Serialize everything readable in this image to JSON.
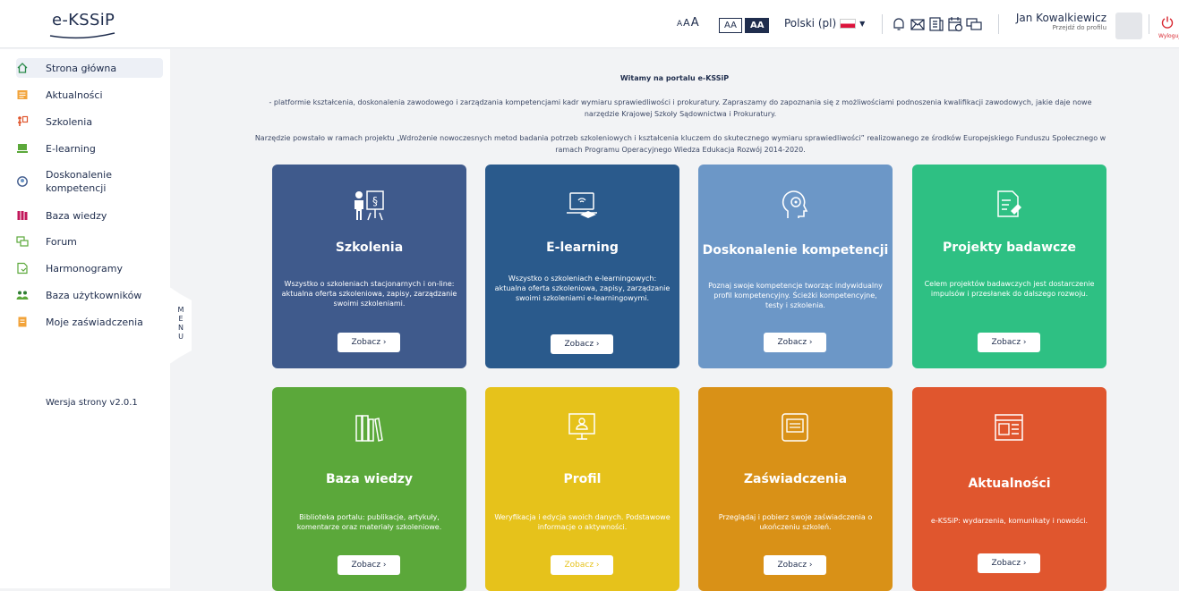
{
  "header": {
    "logo": "e-KSSiP",
    "font_sizes": [
      "A",
      "A",
      "A"
    ],
    "contrast": [
      "AA",
      "AA"
    ],
    "language": "Polski (pl)",
    "user_name": "Jan Kowalkiewicz",
    "user_link": "Przejdź do profilu",
    "logout_label": "Wyloguj"
  },
  "sidebar": {
    "items": [
      {
        "label": "Strona główna",
        "icon": "home-icon"
      },
      {
        "label": "Aktualności",
        "icon": "news-icon"
      },
      {
        "label": "Szkolenia",
        "icon": "training-icon"
      },
      {
        "label": "E-learning",
        "icon": "elearning-icon"
      },
      {
        "label": "Doskonalenie kompetencji",
        "icon": "competence-icon"
      },
      {
        "label": "Baza wiedzy",
        "icon": "library-icon"
      },
      {
        "label": "Forum",
        "icon": "forum-icon"
      },
      {
        "label": "Harmonogramy",
        "icon": "schedule-icon"
      },
      {
        "label": "Baza użytkowników",
        "icon": "users-icon"
      },
      {
        "label": "Moje zaświadczenia",
        "icon": "certificate-icon"
      }
    ],
    "version": "Wersja strony v2.0.1",
    "menu_tab": "MENU"
  },
  "main": {
    "welcome": "Witamy na portalu e-KSSiP",
    "intro_1": "- platformie kształcenia, doskonalenia zawodowego i zarządzania kompetencjami kadr wymiaru sprawiedliwości i prokuratury. Zapraszamy do zapoznania się z możliwościami podnoszenia kwalifikacji zawodowych, jakie daje nowe narzędzie Krajowej Szkoły Sądownictwa i Prokuratury.",
    "intro_2": "Narzędzie powstało w ramach projektu „Wdrożenie nowoczesnych metod badania potrzeb szkoleniowych i kształcenia kluczem do skutecznego wymiaru sprawiedliwości” realizowanego ze środków Europejskiego Funduszu Społecznego w ramach Programu Operacyjnego Wiedza Edukacja Rozwój 2014-2020.",
    "cards": [
      {
        "title": "Szkolenia",
        "desc": "Wszystko o szkoleniach stacjonarnych i on-line: aktualna oferta szkoleniowa, zapisy, zarządzanie swoimi szkoleniami.",
        "button": "Zobacz  ›",
        "color": "#3f5a8c",
        "icon": "trainer-board-icon"
      },
      {
        "title": "E-learning",
        "desc": "Wszystko o szkoleniach e-learningowych: aktualna oferta szkoleniowa, zapisy, zarządzanie swoimi szkoleniami e-learningowymi.",
        "button": "Zobacz  ›",
        "color": "#2a5a8c",
        "icon": "laptop-graduation-icon"
      },
      {
        "title": "Doskonalenie kompetencji",
        "desc": "Poznaj swoje kompetencje tworząc indywidualny profil kompetencyjny. Ścieżki kompetencyjne, testy i szkolenia.",
        "button": "Zobacz  ›",
        "color": "#6c97c7",
        "icon": "head-gear-icon"
      },
      {
        "title": "Projekty badawcze",
        "desc": "Celem projektów badawczych jest dostarczenie impulsów i przesłanek do dalszego rozwoju.",
        "button": "Zobacz  ›",
        "color": "#2ec083",
        "icon": "research-doc-icon"
      },
      {
        "title": "Baza wiedzy",
        "desc": "Biblioteka portalu: publikacje, artykuły, komentarze oraz materiały szkoleniowe.",
        "button": "Zobacz  ›",
        "color": "#5ba83a",
        "icon": "books-icon"
      },
      {
        "title": "Profil",
        "desc": "Weryfikacja i edycja swoich danych. Podstawowe informacje o aktywności.",
        "button": "Zobacz  ›",
        "color": "#e6c21b",
        "icon": "profile-monitor-icon"
      },
      {
        "title": "Zaświadczenia",
        "desc": "Przeglądaj i pobierz swoje zaświadczenia o ukończeniu szkoleń.",
        "button": "Zobacz  ›",
        "color": "#d99117",
        "icon": "certificate-frame-icon"
      },
      {
        "title": "Aktualności",
        "desc": "e-KSSiP: wydarzenia, komunikaty i nowości.",
        "button": "Zobacz  ›",
        "color": "#e0562e",
        "icon": "news-browser-icon"
      }
    ]
  },
  "colors": {
    "navy": "#1f2d4d",
    "logout": "#d8262f"
  }
}
